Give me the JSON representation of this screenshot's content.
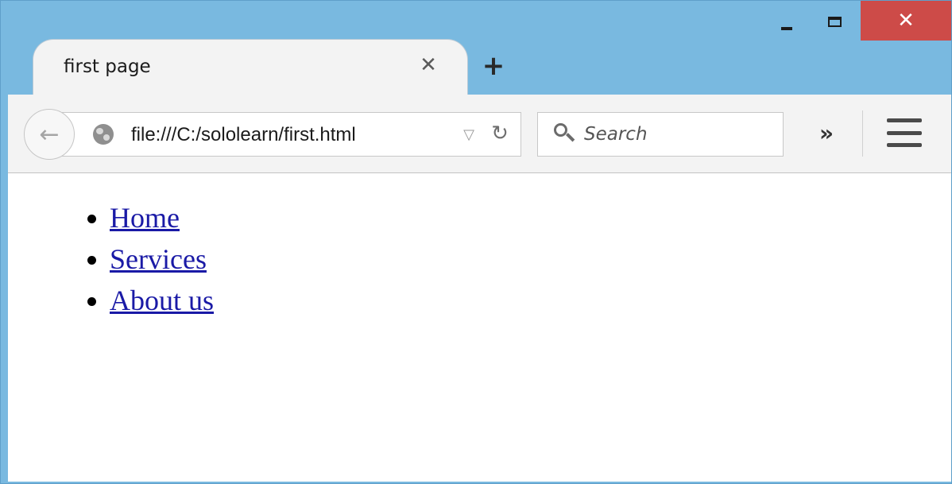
{
  "window": {
    "controls": {
      "minimize": "minimize",
      "maximize": "maximize",
      "close": "close",
      "close_glyph": "✕"
    }
  },
  "tab": {
    "title": "first page",
    "close_glyph": "✕",
    "new_tab_glyph": "+"
  },
  "toolbar": {
    "back_glyph": "←",
    "url": "file:///C:/sololearn/first.html",
    "dropdown_glyph": "▽",
    "reload_glyph": "↻",
    "search_placeholder": "Search",
    "overflow_glyph": "»"
  },
  "content": {
    "nav": [
      {
        "label": "Home"
      },
      {
        "label": "Services"
      },
      {
        "label": "About us"
      }
    ]
  },
  "colors": {
    "frame": "#79b9e0",
    "close_button": "#cd4b48",
    "link": "#1a1aa6"
  },
  "icons": [
    "minimize-icon",
    "maximize-icon",
    "close-icon",
    "back-arrow-icon",
    "globe-icon",
    "dropdown-icon",
    "reload-icon",
    "search-icon",
    "overflow-chevron-icon",
    "hamburger-menu-icon"
  ]
}
